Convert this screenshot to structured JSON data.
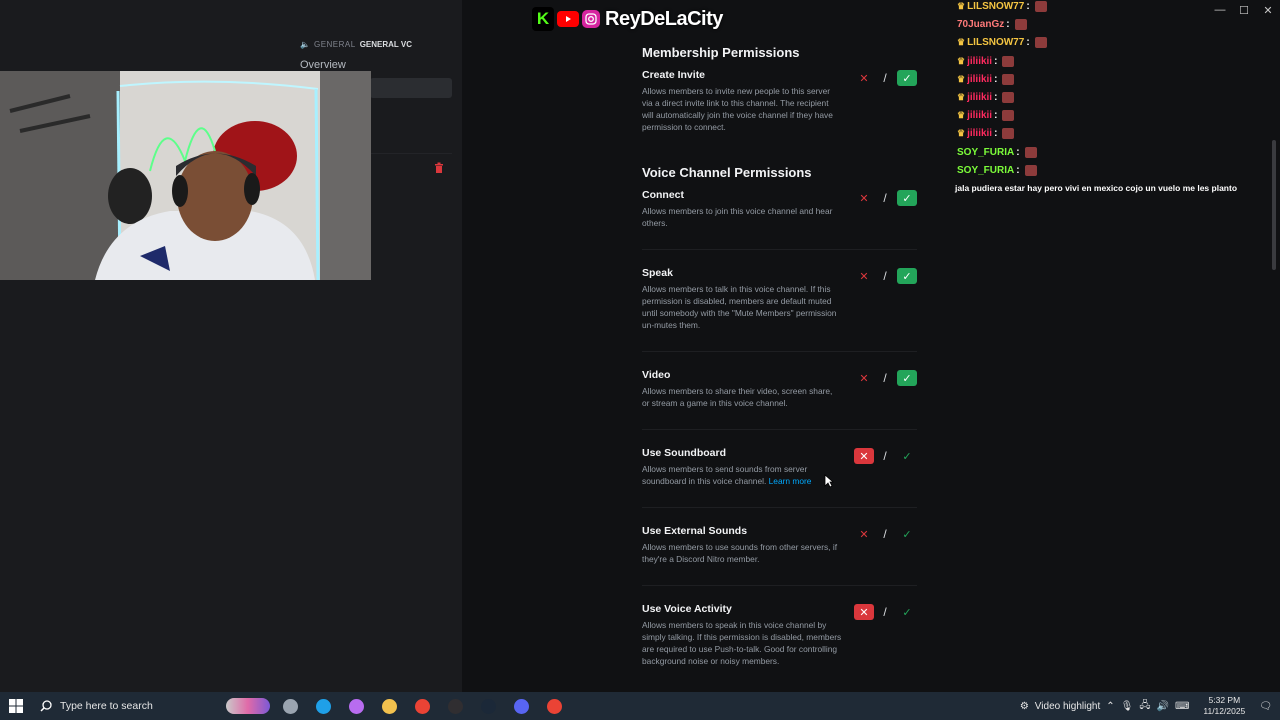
{
  "channel": {
    "category": "GENERAL",
    "name": "GENERAL VC",
    "overview_label": "Overview"
  },
  "banner": {
    "name": "ReyDeLaCity",
    "kick_letter": "K"
  },
  "sections": {
    "membership_title": "Membership Permissions",
    "voice_title": "Voice Channel Permissions"
  },
  "permissions": [
    {
      "name": "Create Invite",
      "desc": "Allows members to invite new people to this server via a direct invite link to this channel. The recipient will automatically join the voice channel if they have permission to connect.",
      "state": "allow"
    },
    {
      "name": "Connect",
      "desc": "Allows members to join this voice channel and hear others.",
      "state": "allow"
    },
    {
      "name": "Speak",
      "desc": "Allows members to talk in this voice channel. If this permission is disabled, members are default muted until somebody with the \"Mute Members\" permission un-mutes them.",
      "state": "allow"
    },
    {
      "name": "Video",
      "desc": "Allows members to share their video, screen share, or stream a game in this voice channel.",
      "state": "allow"
    },
    {
      "name": "Use Soundboard",
      "desc": "Allows members to send sounds from server soundboard in this voice channel.",
      "link": "Learn more",
      "state": "deny"
    },
    {
      "name": "Use External Sounds",
      "desc": "Allows members to use sounds from other servers, if they're a Discord Nitro member.",
      "state": "neutral"
    },
    {
      "name": "Use Voice Activity",
      "desc": "Allows members to speak in this voice channel by simply talking. If this permission is disabled, members are required to use Push-to-talk. Good for controlling background noise or noisy members.",
      "state": "deny"
    }
  ],
  "toggle_glyphs": {
    "deny": "✕",
    "neutral": "/",
    "allow": "✓"
  },
  "chat": {
    "lines": [
      {
        "user": "LILSNOW77",
        "color": "#f4c542",
        "badge": "crown"
      },
      {
        "user": "70JuanGz",
        "color": "#ff7a7a",
        "badge": ""
      },
      {
        "user": "LILSNOW77",
        "color": "#f4c542",
        "badge": "crown"
      },
      {
        "user": "jiliikii",
        "color": "#ff2a5f",
        "badge": "crown"
      },
      {
        "user": "jiliikii",
        "color": "#ff2a5f",
        "badge": "crown"
      },
      {
        "user": "jiliikii",
        "color": "#ff2a5f",
        "badge": "crown"
      },
      {
        "user": "jiliikii",
        "color": "#ff2a5f",
        "badge": "crown"
      },
      {
        "user": "jiliikii",
        "color": "#ff2a5f",
        "badge": "crown"
      },
      {
        "user": "SOY_FURIA",
        "color": "#7cfc3a",
        "badge": ""
      },
      {
        "user": "SOY_FURIA",
        "color": "#7cfc3a",
        "badge": ""
      }
    ],
    "message": "jala pudiera estar hay pero vivi en mexico cojo un vuelo me les planto"
  },
  "taskbar": {
    "search_placeholder": "Type here to search",
    "video_highlight": "Video highlight",
    "time": "5:32 PM",
    "date": "11/12/2025",
    "apps": [
      {
        "name": "task-view-icon",
        "color": "#9aa4b0"
      },
      {
        "name": "edge-icon",
        "color": "#1fa0e8"
      },
      {
        "name": "copilot-icon",
        "color": "#b86cf0"
      },
      {
        "name": "file-explorer-icon",
        "color": "#f2c14e"
      },
      {
        "name": "chrome-icon",
        "color": "#ea4335"
      },
      {
        "name": "obs-icon",
        "color": "#302e31"
      },
      {
        "name": "steam-icon",
        "color": "#1b2838"
      },
      {
        "name": "discord-icon",
        "color": "#5865f2"
      },
      {
        "name": "chrome-icon-2",
        "color": "#ea4335"
      }
    ]
  }
}
